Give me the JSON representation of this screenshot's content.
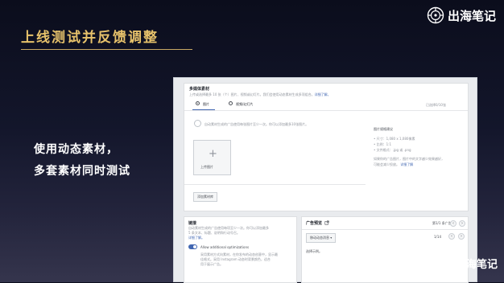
{
  "slide": {
    "title": "上线测试并反馈调整",
    "caption_line1": "使用动态素材，",
    "caption_line2": "多套素材同时测试",
    "brand_name": "出海笔记",
    "wechat_name": "出海笔记",
    "accent_color": "#e7c26b"
  },
  "screenshot": {
    "top_panel": {
      "heading": "多媒体素材",
      "subtitle": "上传或选择最多 10 张（个）图片、视频或幻灯片。我们会使用动态素材生成多项组合。",
      "subtitle_link": "详细了解。",
      "tab_images": "图片",
      "tab_video": "视频/幻灯片",
      "count": "已选择0/10张",
      "hint": "自动素材生成的广告使用每张图片至少一次。你可以添加最多10张图片。",
      "upload_label": "上传图片",
      "add_button": "添加素材库",
      "specs_title": "图片规格建议",
      "spec_size": "• 尺寸：1,080 x 1,080像素",
      "spec_ratio": "• 比例：1:1",
      "spec_format": "• 文件格式：.jpg 或 .png",
      "spec_note1": "如果你的广告图片，图片中的文字越少效果越好，",
      "spec_note2": "可能会减少投放。",
      "spec_link": "详细了解"
    },
    "left_panel": {
      "heading": "链接",
      "desc1": "自动素材生成的广告使用每项至少一次。你可以添加最多",
      "desc2": "5 条文本、标题、说明和行动号召。",
      "desc_link": "详细了解。",
      "toggle_label": "Allow additional optimizations",
      "body1": "采用素材方式向素材，在你发布的动态创意中，显示最",
      "body2": "佳格式。采用 Instagram 动态时背景颜色，适合",
      "body3": "用于展示广告。"
    },
    "right_panel": {
      "heading": "广告预览",
      "page": "第1/1 条广告",
      "placement": "移动动态消息",
      "counter": "1/14",
      "preview_text": "选择示例。"
    }
  }
}
